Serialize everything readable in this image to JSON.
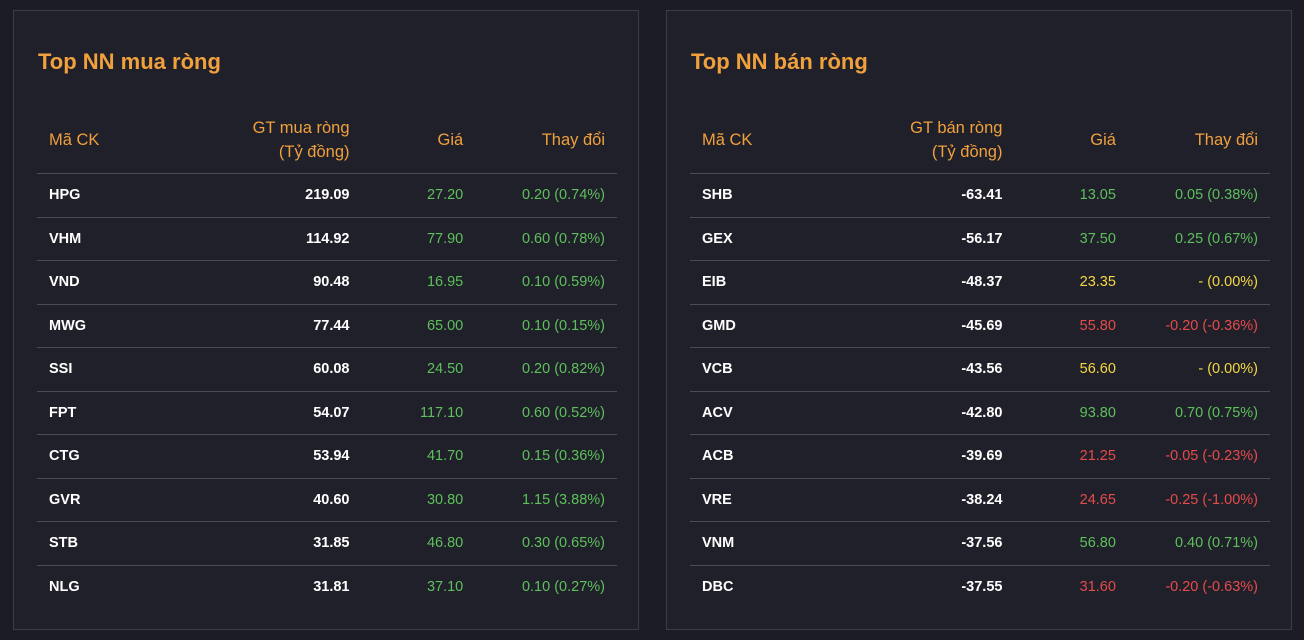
{
  "colors": {
    "title": "#f0a03c",
    "header": "#f0a03c",
    "up": "#5dc05b",
    "down": "#e54b4b",
    "reference": "#f5d742",
    "background": "#20202a"
  },
  "buy": {
    "title": "Top NN mua ròng",
    "headers": {
      "code": "Mã CK",
      "value_line1": "GT mua ròng",
      "value_line2": "(Tỷ đồng)",
      "price": "Giá",
      "change": "Thay đổi"
    },
    "rows": [
      {
        "code": "HPG",
        "value": "219.09",
        "price": "27.20",
        "change": "0.20 (0.74%)",
        "trend": "up"
      },
      {
        "code": "VHM",
        "value": "114.92",
        "price": "77.90",
        "change": "0.60 (0.78%)",
        "trend": "up"
      },
      {
        "code": "VND",
        "value": "90.48",
        "price": "16.95",
        "change": "0.10 (0.59%)",
        "trend": "up"
      },
      {
        "code": "MWG",
        "value": "77.44",
        "price": "65.00",
        "change": "0.10 (0.15%)",
        "trend": "up"
      },
      {
        "code": "SSI",
        "value": "60.08",
        "price": "24.50",
        "change": "0.20 (0.82%)",
        "trend": "up"
      },
      {
        "code": "FPT",
        "value": "54.07",
        "price": "117.10",
        "change": "0.60 (0.52%)",
        "trend": "up"
      },
      {
        "code": "CTG",
        "value": "53.94",
        "price": "41.70",
        "change": "0.15 (0.36%)",
        "trend": "up"
      },
      {
        "code": "GVR",
        "value": "40.60",
        "price": "30.80",
        "change": "1.15 (3.88%)",
        "trend": "up"
      },
      {
        "code": "STB",
        "value": "31.85",
        "price": "46.80",
        "change": "0.30 (0.65%)",
        "trend": "up"
      },
      {
        "code": "NLG",
        "value": "31.81",
        "price": "37.10",
        "change": "0.10 (0.27%)",
        "trend": "up"
      }
    ]
  },
  "sell": {
    "title": "Top NN bán ròng",
    "headers": {
      "code": "Mã CK",
      "value_line1": "GT bán ròng",
      "value_line2": "(Tỷ đồng)",
      "price": "Giá",
      "change": "Thay đổi"
    },
    "rows": [
      {
        "code": "SHB",
        "value": "-63.41",
        "price": "13.05",
        "change": "0.05 (0.38%)",
        "trend": "up"
      },
      {
        "code": "GEX",
        "value": "-56.17",
        "price": "37.50",
        "change": "0.25 (0.67%)",
        "trend": "up"
      },
      {
        "code": "EIB",
        "value": "-48.37",
        "price": "23.35",
        "change": "- (0.00%)",
        "trend": "ref"
      },
      {
        "code": "GMD",
        "value": "-45.69",
        "price": "55.80",
        "change": "-0.20 (-0.36%)",
        "trend": "down"
      },
      {
        "code": "VCB",
        "value": "-43.56",
        "price": "56.60",
        "change": "- (0.00%)",
        "trend": "ref"
      },
      {
        "code": "ACV",
        "value": "-42.80",
        "price": "93.80",
        "change": "0.70 (0.75%)",
        "trend": "up"
      },
      {
        "code": "ACB",
        "value": "-39.69",
        "price": "21.25",
        "change": "-0.05 (-0.23%)",
        "trend": "down"
      },
      {
        "code": "VRE",
        "value": "-38.24",
        "price": "24.65",
        "change": "-0.25 (-1.00%)",
        "trend": "down"
      },
      {
        "code": "VNM",
        "value": "-37.56",
        "price": "56.80",
        "change": "0.40 (0.71%)",
        "trend": "up"
      },
      {
        "code": "DBC",
        "value": "-37.55",
        "price": "31.60",
        "change": "-0.20 (-0.63%)",
        "trend": "down"
      }
    ]
  }
}
